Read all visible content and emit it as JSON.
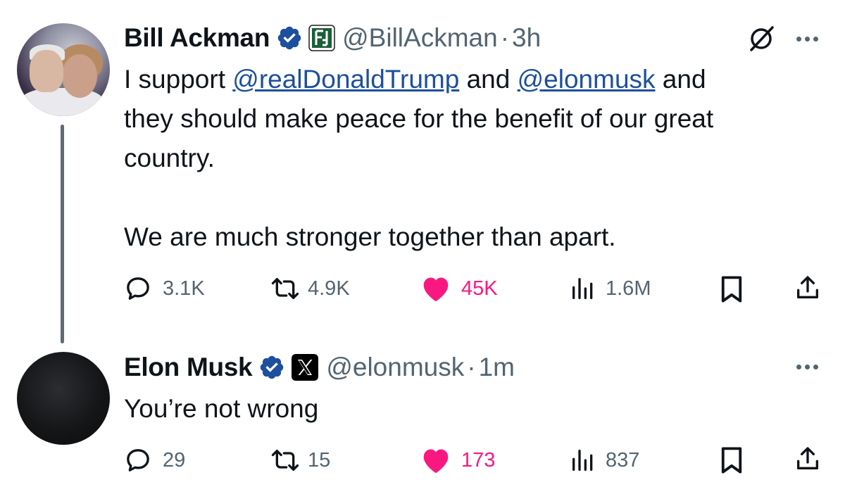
{
  "tweet1": {
    "author_name": "Bill Ackman",
    "handle": "@BillAckman",
    "separator": "·",
    "time": "3h",
    "text_line1_pre": "I support ",
    "mention1": "@realDonaldTrump",
    "text_line1_mid": " and ",
    "mention2": "@elonmusk",
    "text_line1_post": " and",
    "text_line2": "they should make peace for the benefit of our great",
    "text_line3": "country.",
    "text_line4": "We are much stronger together than apart.",
    "replies": "3.1K",
    "reposts": "4.9K",
    "likes": "45K",
    "views": "1.6M"
  },
  "tweet2": {
    "author_name": "Elon Musk",
    "handle": "@elonmusk",
    "separator": "·",
    "time": "1m",
    "text": "You’re not wrong",
    "replies": "29",
    "reposts": "15",
    "likes": "173",
    "views": "837"
  },
  "icons": [
    "verified-badge-icon",
    "affiliate-badge-icon",
    "x-logo-icon",
    "grok-icon",
    "more-icon",
    "reply-icon",
    "repost-icon",
    "like-icon",
    "views-icon",
    "bookmark-icon",
    "share-icon"
  ],
  "colors": {
    "verified_blue": "#1d4f9e",
    "like_pink": "#f91880",
    "secondary_gray": "#536471",
    "text": "#0f1419"
  }
}
